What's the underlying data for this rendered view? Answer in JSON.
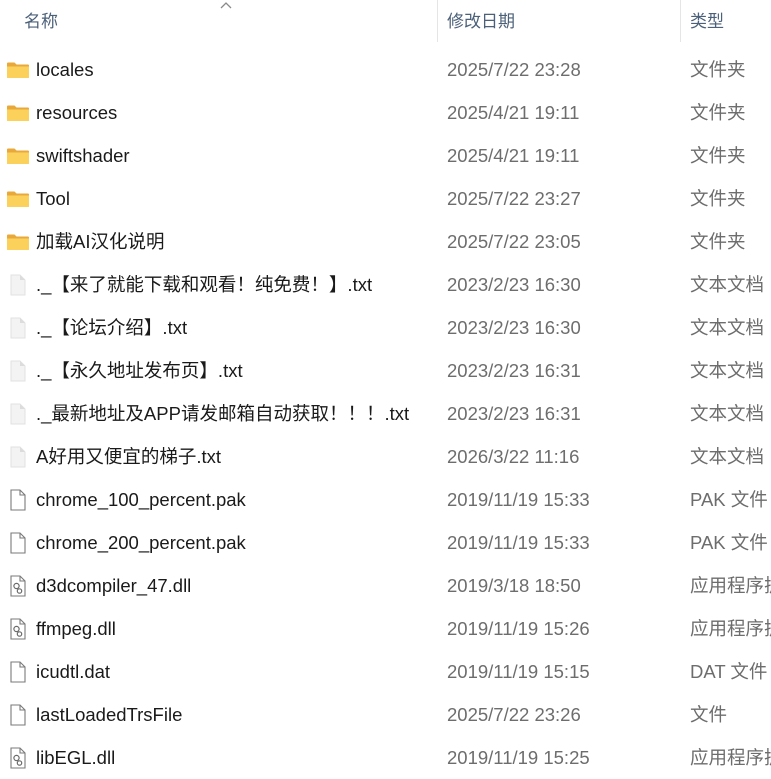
{
  "columns": {
    "name": "名称",
    "date": "修改日期",
    "type": "类型"
  },
  "sort": {
    "column": "name",
    "direction": "ascending"
  },
  "files": [
    {
      "name": "locales",
      "date": "2025/7/22 23:28",
      "type": "文件夹",
      "icon": "folder-icon"
    },
    {
      "name": "resources",
      "date": "2025/4/21 19:11",
      "type": "文件夹",
      "icon": "folder-icon"
    },
    {
      "name": "swiftshader",
      "date": "2025/4/21 19:11",
      "type": "文件夹",
      "icon": "folder-icon"
    },
    {
      "name": "Tool",
      "date": "2025/7/22 23:27",
      "type": "文件夹",
      "icon": "folder-icon"
    },
    {
      "name": "加载AI汉化说明",
      "date": "2025/7/22 23:05",
      "type": "文件夹",
      "icon": "folder-icon"
    },
    {
      "name": "._【来了就能下载和观看！纯免费！】.txt",
      "date": "2023/2/23 16:30",
      "type": "文本文档",
      "icon": "text-file-icon"
    },
    {
      "name": "._【论坛介绍】.txt",
      "date": "2023/2/23 16:30",
      "type": "文本文档",
      "icon": "text-file-icon"
    },
    {
      "name": "._【永久地址发布页】.txt",
      "date": "2023/2/23 16:31",
      "type": "文本文档",
      "icon": "text-file-icon"
    },
    {
      "name": "._最新地址及APP请发邮箱自动获取！！！.txt",
      "date": "2023/2/23 16:31",
      "type": "文本文档",
      "icon": "text-file-icon"
    },
    {
      "name": "A好用又便宜的梯子.txt",
      "date": "2026/3/22 11:16",
      "type": "文本文档",
      "icon": "text-file-icon"
    },
    {
      "name": "chrome_100_percent.pak",
      "date": "2019/11/19 15:33",
      "type": "PAK 文件",
      "icon": "file-icon"
    },
    {
      "name": "chrome_200_percent.pak",
      "date": "2019/11/19 15:33",
      "type": "PAK 文件",
      "icon": "file-icon"
    },
    {
      "name": "d3dcompiler_47.dll",
      "date": "2019/3/18 18:50",
      "type": "应用程序扩展",
      "icon": "dll-file-icon"
    },
    {
      "name": "ffmpeg.dll",
      "date": "2019/11/19 15:26",
      "type": "应用程序扩展",
      "icon": "dll-file-icon"
    },
    {
      "name": "icudtl.dat",
      "date": "2019/11/19 15:15",
      "type": "DAT 文件",
      "icon": "file-icon"
    },
    {
      "name": "lastLoadedTrsFile",
      "date": "2025/7/22 23:26",
      "type": "文件",
      "icon": "file-icon"
    },
    {
      "name": "libEGL.dll",
      "date": "2019/11/19 15:25",
      "type": "应用程序扩展",
      "icon": "dll-file-icon"
    }
  ]
}
